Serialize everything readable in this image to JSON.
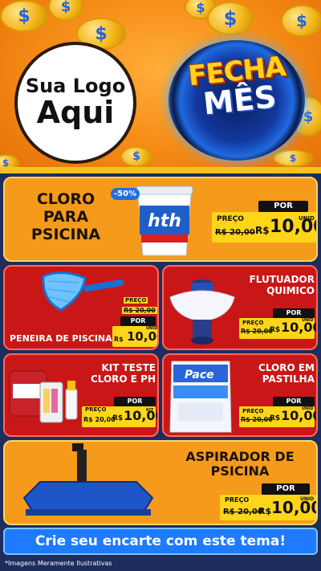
{
  "header": {
    "logo_line1": "Sua Logo",
    "logo_line2": "Aqui",
    "badge_line1": "FECHA",
    "badge_line2": "MÊS",
    "coin_symbol": "$"
  },
  "products": [
    {
      "title_lines": [
        "CLORO",
        "PARA",
        "PSICINA"
      ],
      "discount": "-50%",
      "brand": "hth",
      "por": "POR",
      "preco": "PREÇO",
      "old_price": "R$ 20,00",
      "currency": "R$",
      "price": "10,00",
      "unid": "UNID"
    },
    {
      "title": "PENEIRA DE PISCINA",
      "por": "POR",
      "preco": "PREÇO",
      "old_price": "R$ 20,00",
      "currency": "R$",
      "price": "10,00",
      "unid": "UNID"
    },
    {
      "title_lines": [
        "FLUTUADOR",
        "QUIMICO"
      ],
      "por": "POR",
      "preco": "PREÇO",
      "old_price": "R$ 20,00",
      "currency": "R$",
      "price": "10,00",
      "unid": "UNID"
    },
    {
      "title_lines": [
        "KIT TESTE",
        "CLORO E PH"
      ],
      "por": "POR",
      "preco": "PREÇO",
      "old_price": "R$ 20,00",
      "currency": "R$",
      "price": "10,00",
      "unid": "KIT"
    },
    {
      "title_lines": [
        "CLORO EM",
        "PASTILHA"
      ],
      "brand": "Pace",
      "por": "POR",
      "preco": "PREÇO",
      "old_price": "R$ 20,00",
      "currency": "R$",
      "price": "10,00",
      "unid": "UNID"
    },
    {
      "title_lines": [
        "ASPIRADOR DE",
        "PSICINA"
      ],
      "por": "POR",
      "preco": "PREÇO",
      "old_price": "R$ 20,00",
      "currency": "R$",
      "price": "10,00",
      "unid": "UNID"
    }
  ],
  "cta": "Crie seu encarte com este tema!",
  "footnote": "*Imagens Meramente Ilustrativas",
  "colors": {
    "orange": "#f59a1b",
    "red": "#c91717",
    "yellow": "#ffd51a",
    "blue": "#1e7bff"
  }
}
